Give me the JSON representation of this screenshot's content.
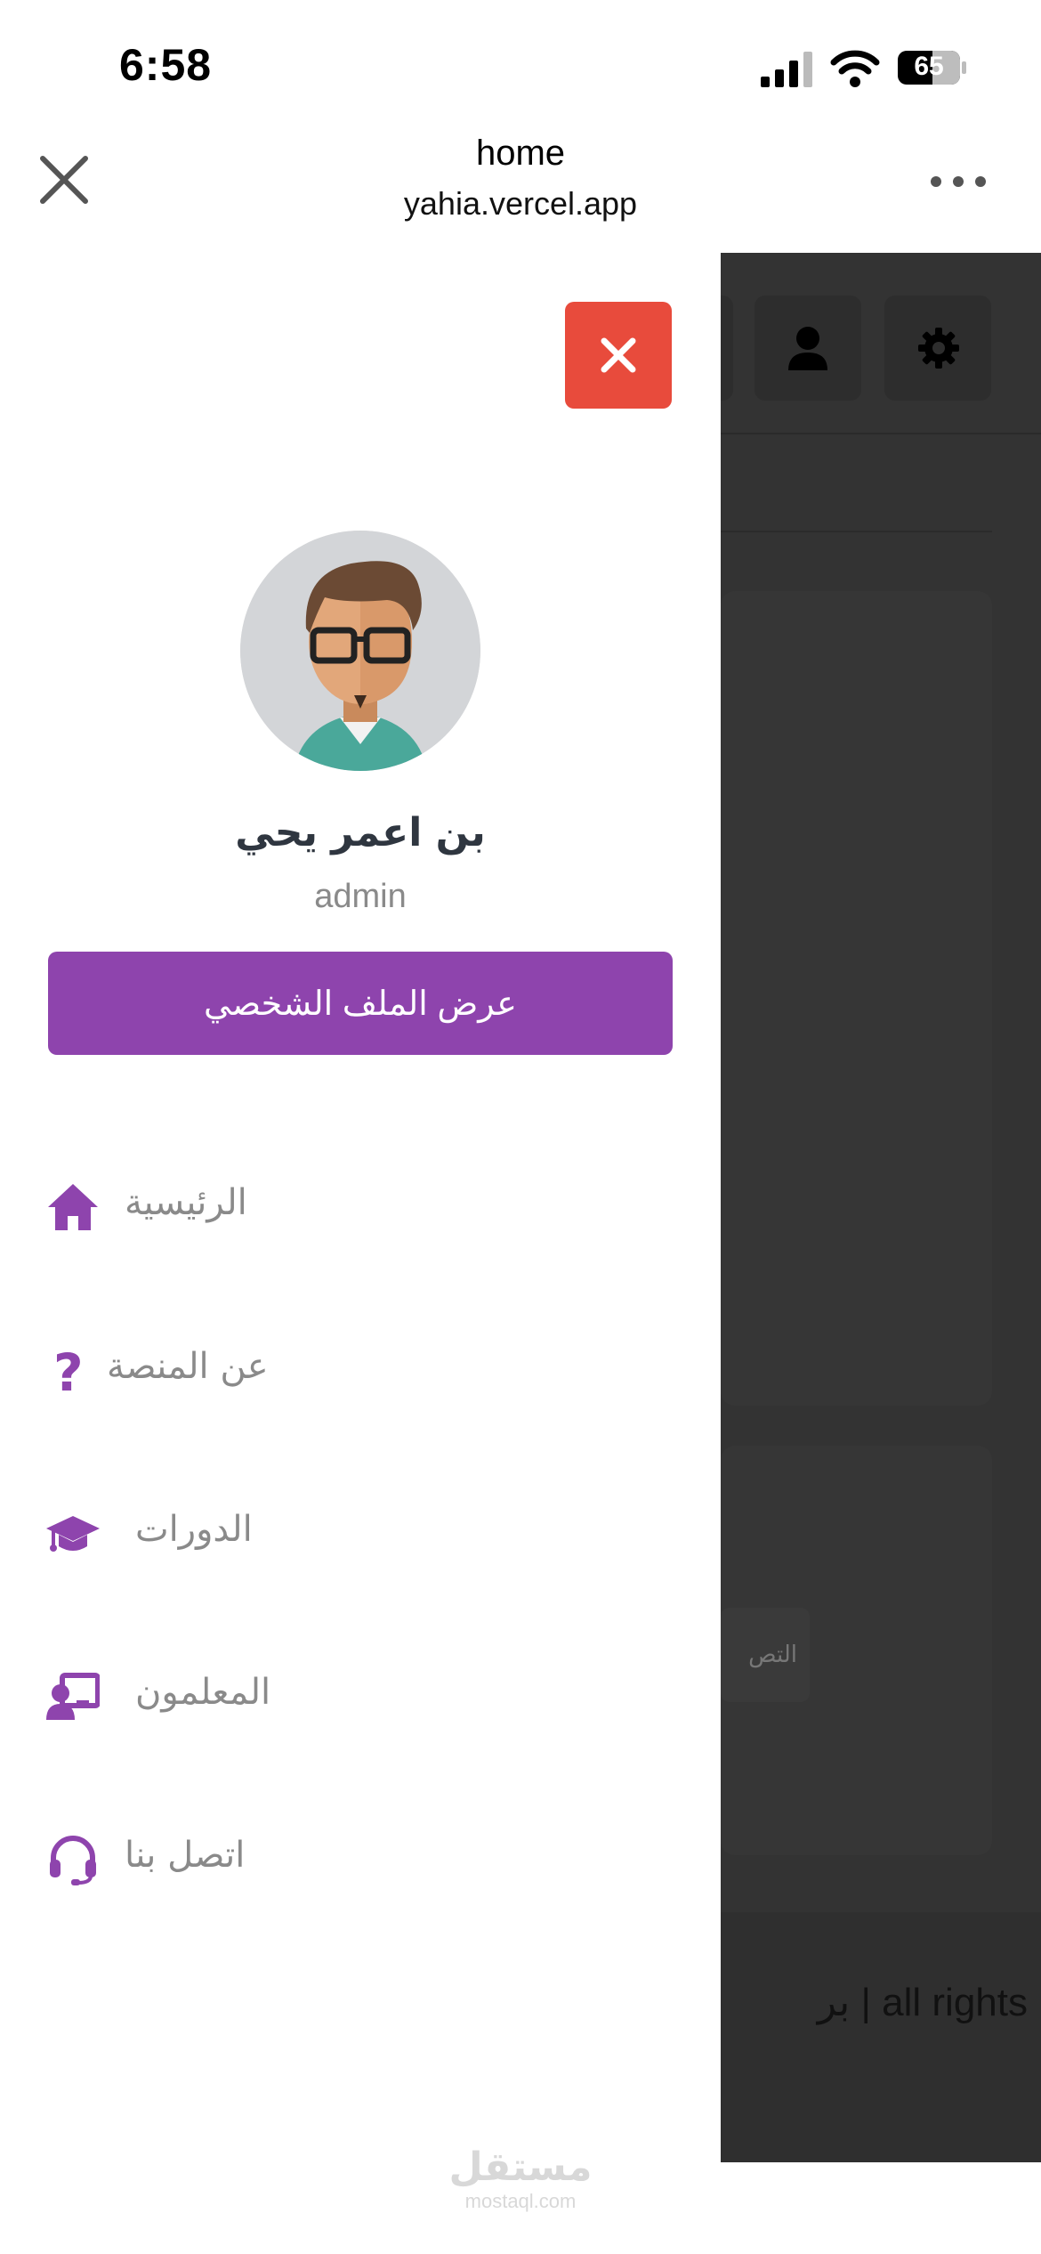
{
  "status_bar": {
    "time": "6:58",
    "battery": "65"
  },
  "browser": {
    "title": "home",
    "url": "yahia.vercel.app"
  },
  "drawer": {
    "user_name": "بن اعمر يحي",
    "user_role": "admin",
    "profile_button": "عرض الملف الشخصي",
    "nav": [
      {
        "label": "الرئيسية",
        "icon": "home-icon"
      },
      {
        "label": "عن المنصة",
        "icon": "question-icon"
      },
      {
        "label": "الدورات",
        "icon": "graduation-cap-icon"
      },
      {
        "label": "المعلمون",
        "icon": "teacher-icon"
      },
      {
        "label": "اتصل بنا",
        "icon": "headset-icon"
      }
    ]
  },
  "background_page": {
    "chip_text": "التص",
    "footer_text": "بر | all rights"
  },
  "watermark": {
    "arabic": "مستقل",
    "latin": "mostaql.com"
  },
  "colors": {
    "accent": "#8e44ad",
    "close_button": "#e84b3c",
    "overlay": "#333333"
  }
}
